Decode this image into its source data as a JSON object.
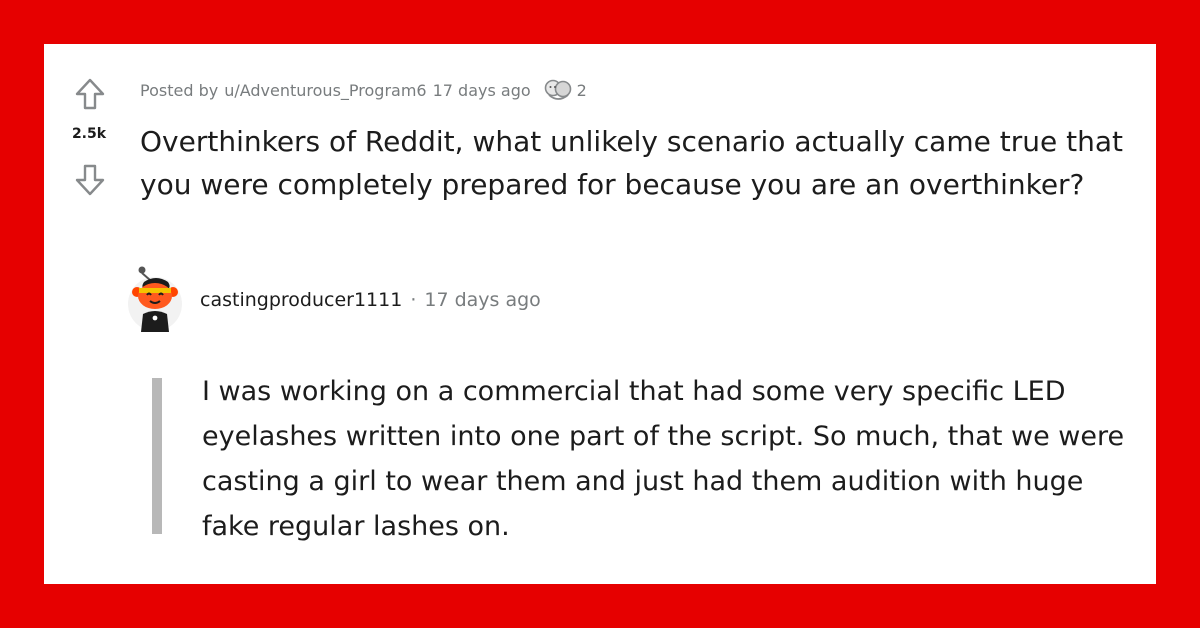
{
  "colors": {
    "frame": "#e60000",
    "card": "#ffffff",
    "text": "#1c1c1c",
    "muted": "#787c7e",
    "thread_line": "#b8b8b8"
  },
  "post": {
    "vote": {
      "score": "2.5k",
      "up_icon": "arrow-up-outline-icon",
      "down_icon": "arrow-down-outline-icon"
    },
    "meta": {
      "posted_by_label": "Posted by",
      "author": "u/Adventurous_Program6",
      "time": "17 days ago",
      "award_icon": "hugz-award-icon",
      "award_count": "2"
    },
    "title": "Overthinkers of Reddit, what unlikely scenario actually came true that you were completely prepared for because you are an overthinker?"
  },
  "comment": {
    "avatar_icon": "snoo-avatar-icon",
    "author": "castingproducer1111",
    "separator": "·",
    "time": "17 days ago",
    "body": "I was working on a commercial that had some very specific LED eyelashes written into one part of the script. So much, that we were casting a girl to wear them and just had them audition with huge fake regular lashes on."
  }
}
